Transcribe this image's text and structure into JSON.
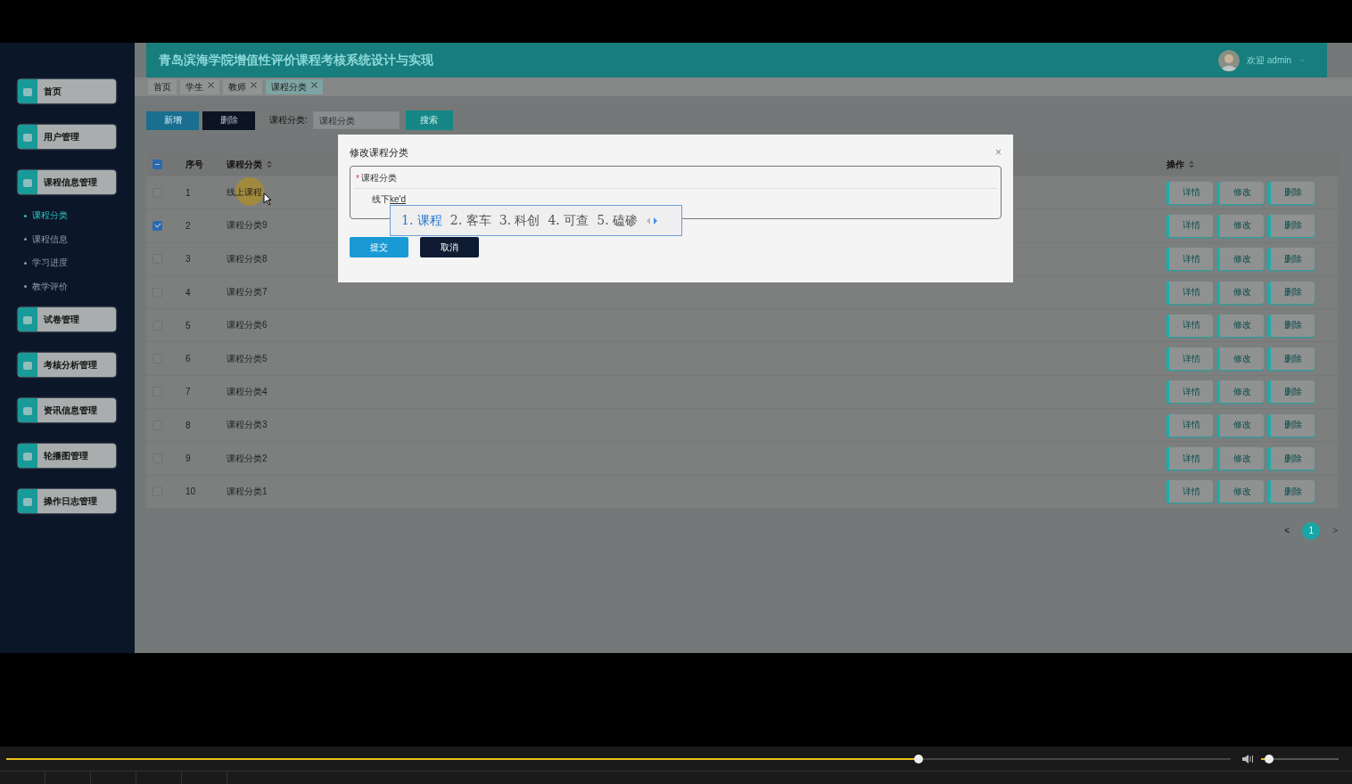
{
  "app_title": "青岛滨海学院增值性评价课程考核系统设计与实现",
  "user": {
    "greeting": "欢迎 admin"
  },
  "sidebar": {
    "items": [
      {
        "label": "首页"
      },
      {
        "label": "用户管理"
      },
      {
        "label": "课程信息管理",
        "children": [
          {
            "label": "课程分类",
            "selected": true
          },
          {
            "label": "课程信息",
            "selected": false
          },
          {
            "label": "学习进度",
            "selected": false
          },
          {
            "label": "教学评价",
            "selected": false
          }
        ]
      },
      {
        "label": "试卷管理"
      },
      {
        "label": "考核分析管理"
      },
      {
        "label": "资讯信息管理"
      },
      {
        "label": "轮播图管理"
      },
      {
        "label": "操作日志管理"
      }
    ]
  },
  "tabs": [
    {
      "label": "首页",
      "closable": false,
      "selected": false
    },
    {
      "label": "学生",
      "closable": true,
      "selected": false
    },
    {
      "label": "教师",
      "closable": true,
      "selected": false
    },
    {
      "label": "课程分类",
      "closable": true,
      "selected": true
    }
  ],
  "toolbar": {
    "add_button": "新增",
    "delete_button": "删除",
    "search_label": "课程分类:",
    "search_placeholder": "课程分类",
    "search_button": "搜索"
  },
  "table": {
    "select_all": {
      "indeterminate": true
    },
    "columns": [
      {
        "label": "序号",
        "sortable": false
      },
      {
        "label": "课程分类",
        "sortable": true
      },
      {
        "label": "操作",
        "sortable": true
      }
    ],
    "rows": [
      {
        "index": "1",
        "category": "线上课程",
        "checked": false,
        "actions": [
          "详情",
          "修改",
          "删除"
        ]
      },
      {
        "index": "2",
        "category": "课程分类9",
        "checked": true,
        "actions": [
          "详情",
          "修改",
          "删除"
        ]
      },
      {
        "index": "3",
        "category": "课程分类8",
        "checked": false,
        "actions": [
          "详情",
          "修改",
          "删除"
        ]
      },
      {
        "index": "4",
        "category": "课程分类7",
        "checked": false,
        "actions": [
          "详情",
          "修改",
          "删除"
        ]
      },
      {
        "index": "5",
        "category": "课程分类6",
        "checked": false,
        "actions": [
          "详情",
          "修改",
          "删除"
        ]
      },
      {
        "index": "6",
        "category": "课程分类5",
        "checked": false,
        "actions": [
          "详情",
          "修改",
          "删除"
        ]
      },
      {
        "index": "7",
        "category": "课程分类4",
        "checked": false,
        "actions": [
          "详情",
          "修改",
          "删除"
        ]
      },
      {
        "index": "8",
        "category": "课程分类3",
        "checked": false,
        "actions": [
          "详情",
          "修改",
          "删除"
        ]
      },
      {
        "index": "9",
        "category": "课程分类2",
        "checked": false,
        "actions": [
          "详情",
          "修改",
          "删除"
        ]
      },
      {
        "index": "10",
        "category": "课程分类1",
        "checked": false,
        "actions": [
          "详情",
          "修改",
          "删除"
        ]
      }
    ]
  },
  "pagination": {
    "prev": "<",
    "pages": [
      {
        "label": "1",
        "selected": true
      }
    ],
    "next": ">"
  },
  "dialog": {
    "title": "修改课程分类",
    "close": "×",
    "field": {
      "label": "课程分类",
      "required_mark": "*",
      "value": "线下",
      "composition": "ke'd"
    },
    "submit": "提交",
    "cancel": "取消"
  },
  "ime": {
    "candidates": [
      {
        "label": "1. 课程",
        "selected": true
      },
      {
        "label": "2. 客车",
        "selected": false
      },
      {
        "label": "3. 科创",
        "selected": false
      },
      {
        "label": "4. 可查",
        "selected": false
      },
      {
        "label": "5. 磕碜",
        "selected": false
      }
    ]
  },
  "player": {
    "progress": {
      "level": 0.745
    },
    "volume": {
      "level": 0.1
    }
  }
}
